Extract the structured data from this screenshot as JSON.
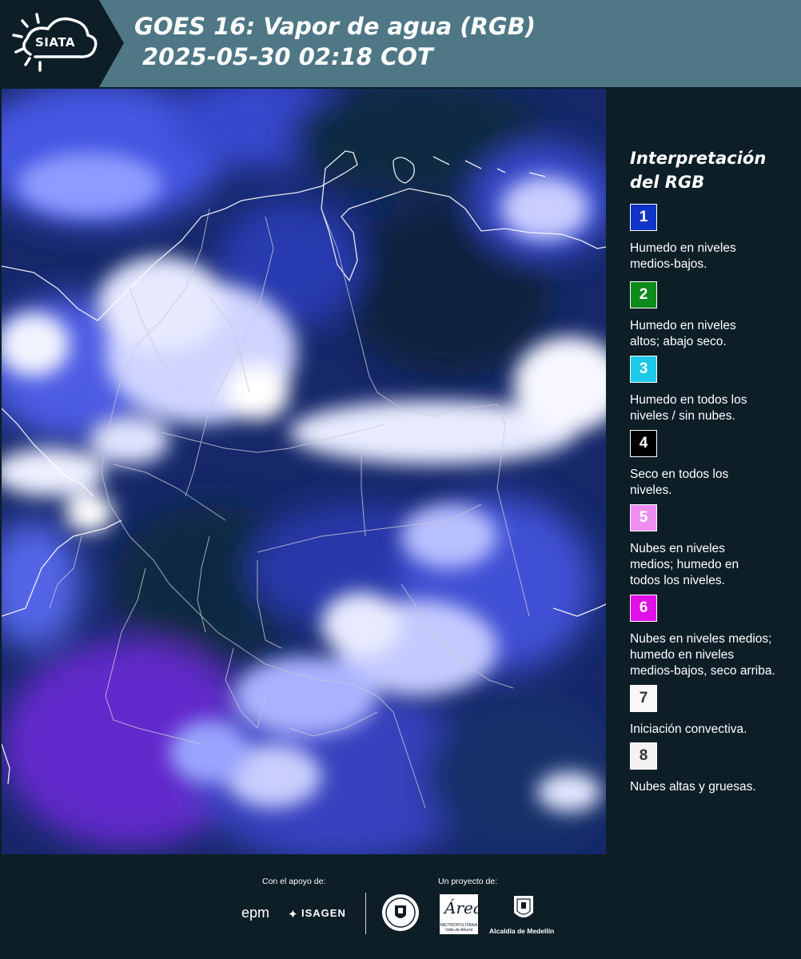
{
  "header": {
    "logo_text": "SIATA",
    "title_line1": "GOES 16: Vapor de agua (RGB)",
    "title_line2": "2025-05-30 02:18 COT"
  },
  "map": {
    "product": "water-vapor-rgb-satellite-image",
    "colors": {
      "background": "#15245a",
      "cloud": "#f4f6ff",
      "moist": "#4b5cf0",
      "dry": "#0d2a3c",
      "violet": "#6a2bd6",
      "borders": "#c8c8d8",
      "coast": "#ffffff"
    }
  },
  "legend": {
    "title_line1": "Interpretación",
    "title_line2": "del RGB",
    "items": [
      {
        "number": "1",
        "color": "#1034c8",
        "line1": "Humedo en niveles",
        "line2": "medios-bajos.",
        "line3": ""
      },
      {
        "number": "2",
        "color": "#0e8a1c",
        "line1": "Humedo en niveles",
        "line2": "altos; abajo seco.",
        "line3": ""
      },
      {
        "number": "3",
        "color": "#1ec8e8",
        "line1": "Humedo en todos los",
        "line2": "niveles / sin nubes.",
        "line3": ""
      },
      {
        "number": "4",
        "color": "#000000",
        "line1": "Seco en todos los",
        "line2": "niveles.",
        "line3": ""
      },
      {
        "number": "5",
        "color": "#f08ef0",
        "line1": "Nubes en niveles",
        "line2": "medios; humedo en",
        "line3": "todos los niveles."
      },
      {
        "number": "6",
        "color": "#e010e6",
        "line1": "Nubes en niveles medios;",
        "line2": "humedo en niveles",
        "line3": "medios-bajos, seco arriba."
      },
      {
        "number": "7",
        "color": "#f8f8f8",
        "line1": "Iniciación convectiva.",
        "line2": "",
        "line3": ""
      },
      {
        "number": "8",
        "color": "#f2f2f2",
        "line1": "Nubes altas y gruesas.",
        "line2": "",
        "line3": ""
      }
    ]
  },
  "footer": {
    "support_label": "Con el apoyo de:",
    "project_label": "Un proyecto de:",
    "sponsor_epm": "epm",
    "sponsor_isagen": "ISAGEN",
    "metro_name": "METROPOLITANA",
    "metro_sub": "Valle de Aburrá",
    "alcaldia": "Alcaldía de Medellín"
  }
}
